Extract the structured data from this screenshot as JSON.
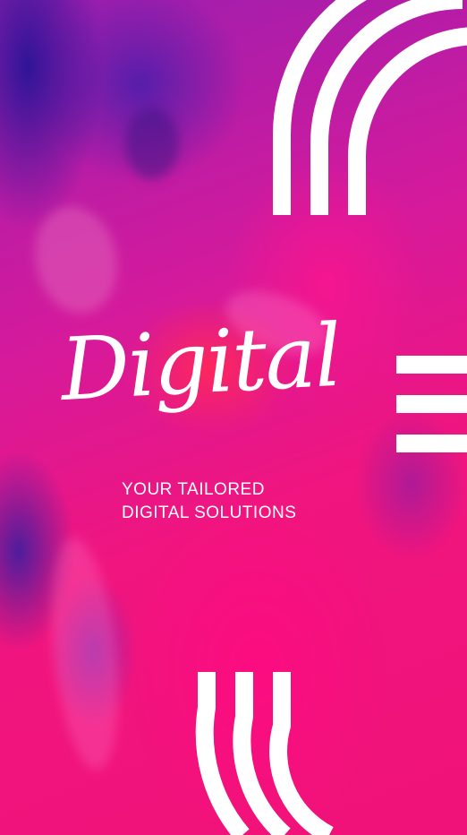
{
  "headline": "Digital",
  "subtitle": {
    "line1": "YOUR TAILORED",
    "line2": "DIGITAL SOLUTIONS"
  },
  "colors": {
    "magenta": "#f01278",
    "purple": "#3a1a9e",
    "accent_white": "#ffffff"
  }
}
